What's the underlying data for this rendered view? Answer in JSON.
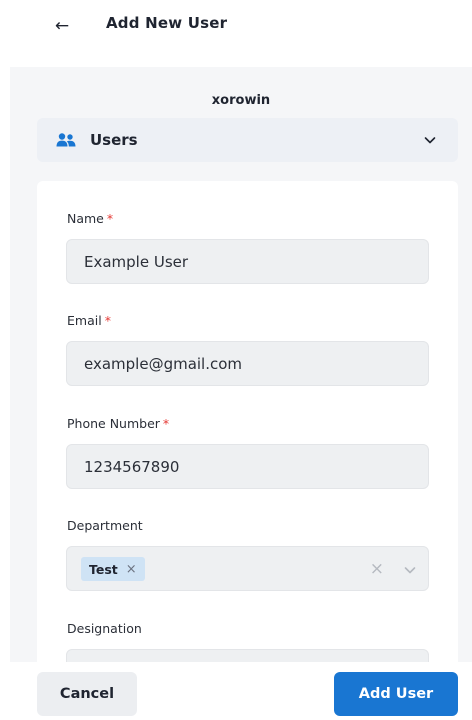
{
  "header": {
    "back_glyph": "←",
    "title": "Add New User"
  },
  "org": {
    "name": "xorowin"
  },
  "module_select": {
    "icon": "users-group-icon",
    "label": "Users",
    "chevron": "chevron-down-icon"
  },
  "form": {
    "required_mark": "*",
    "name": {
      "label": "Name",
      "required": true,
      "value": "Example User"
    },
    "email": {
      "label": "Email",
      "required": true,
      "value": "example@gmail.com"
    },
    "phone": {
      "label": "Phone Number",
      "required": true,
      "value": "1234567890"
    },
    "department": {
      "label": "Department",
      "required": false,
      "tags": [
        {
          "label": "Test",
          "remove_glyph": "×"
        }
      ],
      "clear_glyph": "×"
    },
    "designation": {
      "label": "Designation",
      "required": false,
      "value": ""
    }
  },
  "footer": {
    "cancel_label": "Cancel",
    "add_label": "Add User"
  },
  "colors": {
    "accent": "#1976d2",
    "required": "#e53935",
    "tag_bg": "#cfe3f5",
    "panel_bg": "#f5f6f8",
    "field_bg": "#eef0f2"
  }
}
